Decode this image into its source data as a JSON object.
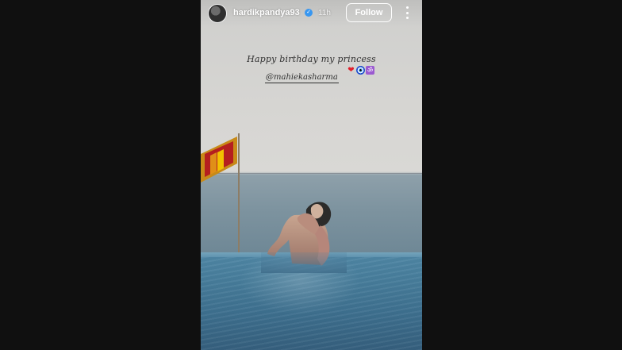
{
  "story": {
    "header": {
      "username": "hardikpandya93",
      "time": "11h",
      "follow_label": "Follow"
    },
    "caption": {
      "text": "Happy birthday my princess",
      "mention": "@mahiekasharma"
    }
  }
}
